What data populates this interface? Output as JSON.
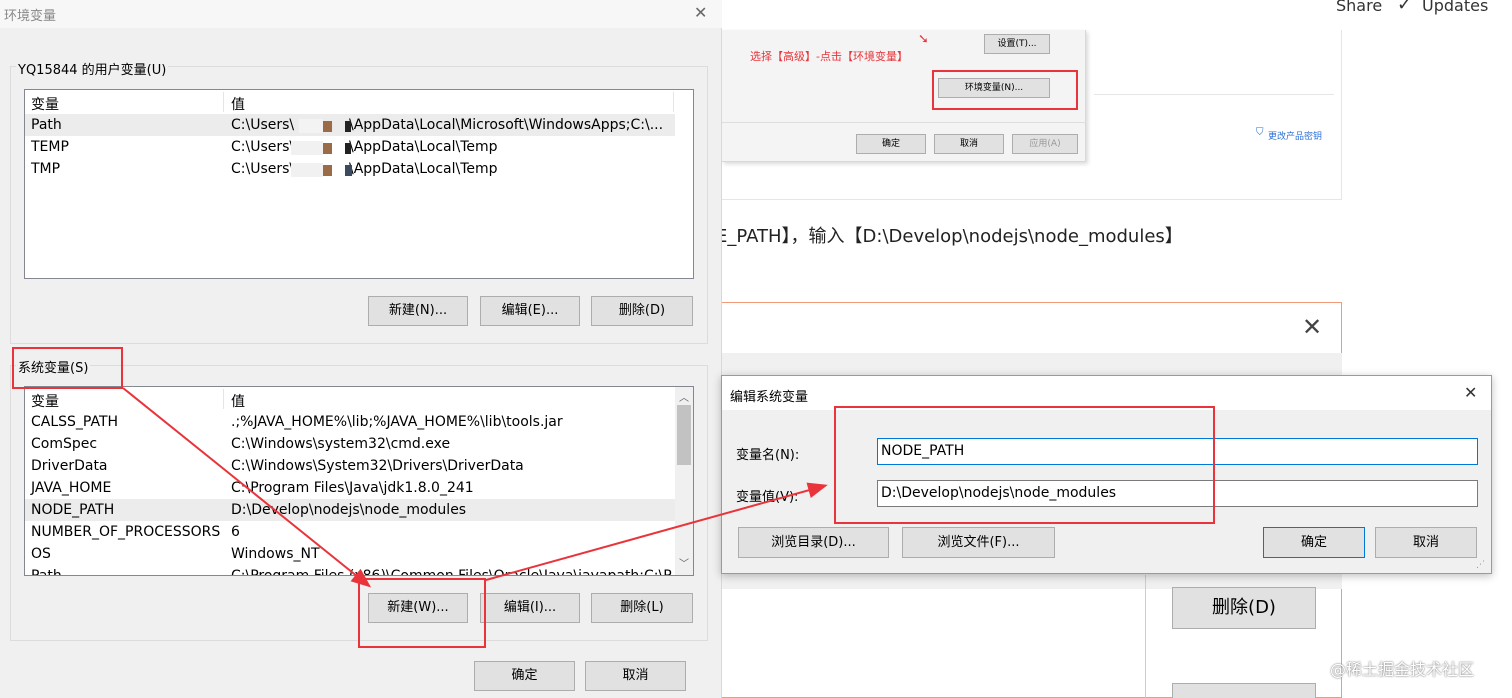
{
  "env_dialog": {
    "title": "环境变量",
    "user_section": {
      "label": "YQ15844 的用户变量(U)",
      "col_var": "变量",
      "col_val": "值",
      "rows": [
        {
          "name": "Path",
          "pre": "C:\\Users\\",
          "post": "\\AppData\\Local\\Microsoft\\WindowsApps;C:\\..."
        },
        {
          "name": "TEMP",
          "pre": "C:\\Users\\",
          "post": "\\AppData\\Local\\Temp"
        },
        {
          "name": "TMP",
          "pre": "C:\\Users\\",
          "post": "\\AppData\\Local\\Temp"
        }
      ],
      "buttons": {
        "new": "新建(N)...",
        "edit": "编辑(E)...",
        "delete": "删除(D)"
      }
    },
    "system_section": {
      "label": "系统变量(S)",
      "col_var": "变量",
      "col_val": "值",
      "rows": [
        {
          "name": "CALSS_PATH",
          "value": ".;%JAVA_HOME%\\lib;%JAVA_HOME%\\lib\\tools.jar"
        },
        {
          "name": "ComSpec",
          "value": "C:\\Windows\\system32\\cmd.exe"
        },
        {
          "name": "DriverData",
          "value": "C:\\Windows\\System32\\Drivers\\DriverData"
        },
        {
          "name": "JAVA_HOME",
          "value": "C:\\Program Files\\Java\\jdk1.8.0_241"
        },
        {
          "name": "NODE_PATH",
          "value": "D:\\Develop\\nodejs\\node_modules"
        },
        {
          "name": "NUMBER_OF_PROCESSORS",
          "value": "6"
        },
        {
          "name": "OS",
          "value": "Windows_NT"
        },
        {
          "name": "Path",
          "value": "C:\\Program Files (x86)\\Common Files\\Oracle\\Java\\javapath;C:\\P..."
        }
      ],
      "buttons": {
        "new": "新建(W)...",
        "edit": "编辑(I)...",
        "delete": "删除(L)"
      }
    },
    "footer": {
      "ok": "确定",
      "cancel": "取消"
    }
  },
  "background": {
    "top_bar": {
      "share": "Share",
      "updates": "Updates"
    },
    "props_panel": {
      "instruction": "选择【高级】-点击【环境变量】",
      "settings_button": "设置(T)...",
      "env_button": "环境变量(N)...",
      "ok": "确定",
      "cancel": "取消",
      "apply": "应用(A)",
      "change_key": "更改产品密钥"
    },
    "article_text": "E_PATH】，输入【D:\\Develop\\nodejs\\node_modules】",
    "delete_button": "删除(D)"
  },
  "edit_dialog": {
    "title": "编辑系统变量",
    "name_label": "变量名(N):",
    "value_label": "变量值(V):",
    "name_value": "NODE_PATH",
    "value_value": "D:\\Develop\\nodejs\\node_modules",
    "browse_dir": "浏览目录(D)...",
    "browse_file": "浏览文件(F)...",
    "ok": "确定",
    "cancel": "取消"
  },
  "watermark": "@稀土掘金技术社区",
  "colors": {
    "annotation_red": "#e8343a",
    "selection_gray": "#ececec",
    "focus_blue": "#0078d7"
  }
}
